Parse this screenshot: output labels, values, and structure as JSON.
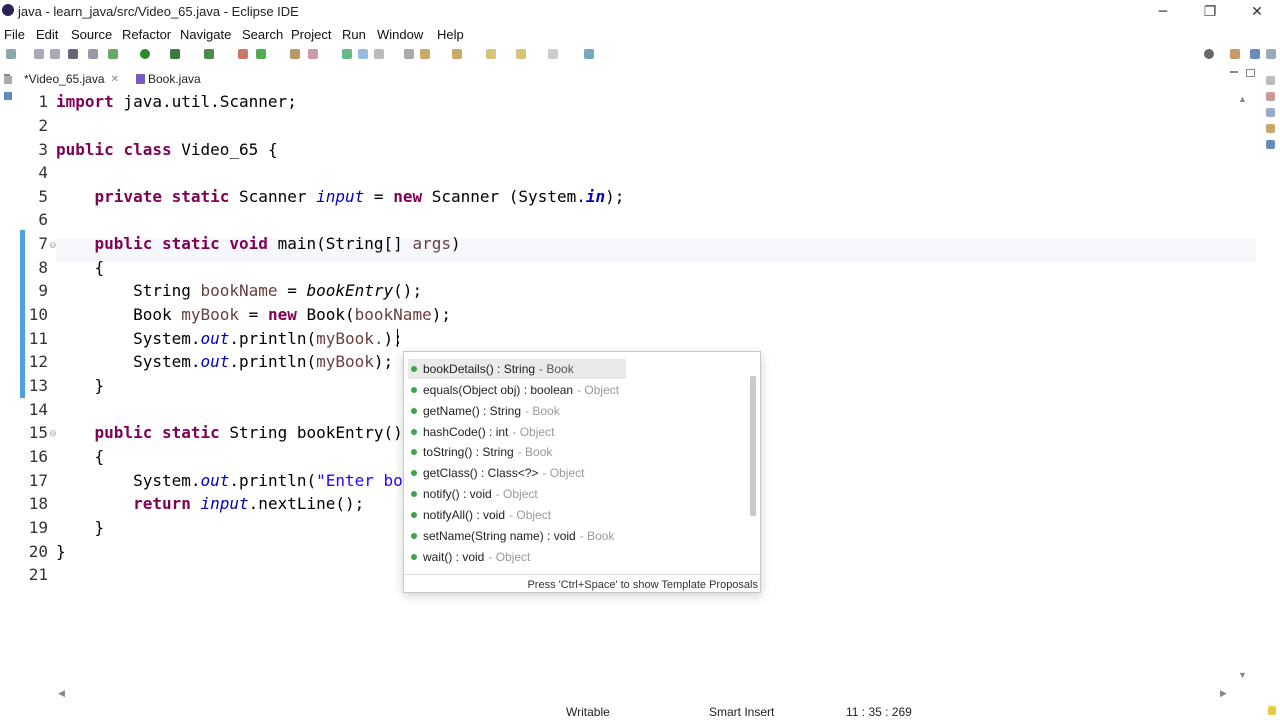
{
  "window": {
    "title": "java - learn_java/src/Video_65.java - Eclipse IDE",
    "minimize": "─",
    "restore": "❐",
    "close": "✕"
  },
  "menu": [
    "File",
    "Edit",
    "Source",
    "Refactor",
    "Navigate",
    "Search",
    "Project",
    "Run",
    "Window",
    "Help"
  ],
  "tabs": [
    {
      "label": "*Video_65.java"
    },
    {
      "label": "Book.java"
    }
  ],
  "editor": {
    "lines": [
      "1",
      "2",
      "3",
      "4",
      "5",
      "6",
      "7",
      "8",
      "9",
      "10",
      "11",
      "12",
      "13",
      "14",
      "15",
      "16",
      "17",
      "18",
      "19",
      "20",
      "21"
    ]
  },
  "popup": {
    "items": [
      {
        "sig": "bookDetails() : String",
        "owner": " - Book"
      },
      {
        "sig": "equals(Object obj) : boolean",
        "owner": " - Object"
      },
      {
        "sig": "getName() : String",
        "owner": " - Book"
      },
      {
        "sig": "hashCode() : int",
        "owner": " - Object"
      },
      {
        "sig": "toString() : String",
        "owner": " - Book"
      },
      {
        "sig": "getClass() : Class<?>",
        "owner": " - Object"
      },
      {
        "sig": "notify() : void",
        "owner": " - Object"
      },
      {
        "sig": "notifyAll() : void",
        "owner": " - Object"
      },
      {
        "sig": "setName(String name) : void",
        "owner": " - Book"
      },
      {
        "sig": "wait() : void",
        "owner": " - Object"
      }
    ],
    "footer": "Press 'Ctrl+Space' to show Template Proposals"
  },
  "status": {
    "mode": "Writable",
    "insert": "Smart Insert",
    "position": "11 : 35 : 269"
  },
  "colors": {
    "keyword": "#7f0055",
    "field": "#0000c0",
    "string": "#2a00ff",
    "selection": "#eaeaea"
  }
}
